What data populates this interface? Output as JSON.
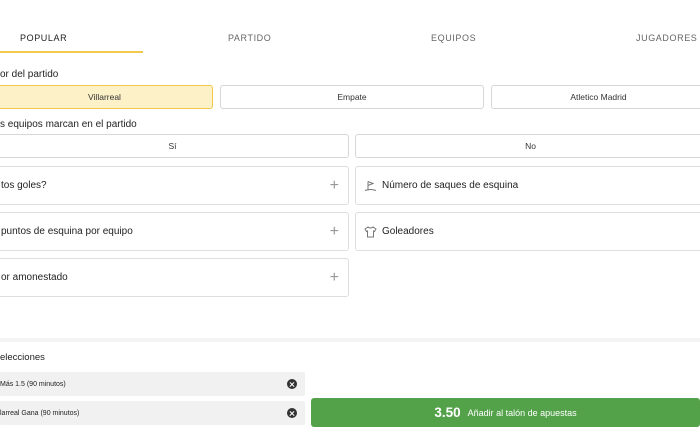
{
  "tabs": [
    {
      "label": "POPULAR"
    },
    {
      "label": "PARTIDO"
    },
    {
      "label": "EQUIPOS"
    },
    {
      "label": "JUGADORES"
    }
  ],
  "winner_market": {
    "title": "or del partido",
    "options": [
      "Villarreal",
      "Empate",
      "Atletico Madrid"
    ],
    "selected": "Villarreal"
  },
  "both_score_market": {
    "title": "s equipos marcan en el partido",
    "options": [
      "Sí",
      "No"
    ]
  },
  "markets_left": [
    {
      "label": "tos goles?"
    },
    {
      "label": "puntos de esquina por equipo"
    },
    {
      "label": "or amonestado"
    }
  ],
  "markets_right": [
    {
      "label": "Número de saques de esquina",
      "icon": "corner-flag-icon"
    },
    {
      "label": "Goleadores",
      "icon": "shirt-icon"
    }
  ],
  "selections": {
    "heading": "elecciones",
    "items": [
      {
        "label": "Más 1.5 (90 minutos)"
      },
      {
        "label": "larreal Gana (90 minutos)"
      }
    ]
  },
  "betslip": {
    "odds": "3.50",
    "add_label": "Añadir al talón de apuestas"
  },
  "colors": {
    "accent": "#f2c94c",
    "selected_bg": "#fdf1c8",
    "add_button": "#53a24a"
  }
}
